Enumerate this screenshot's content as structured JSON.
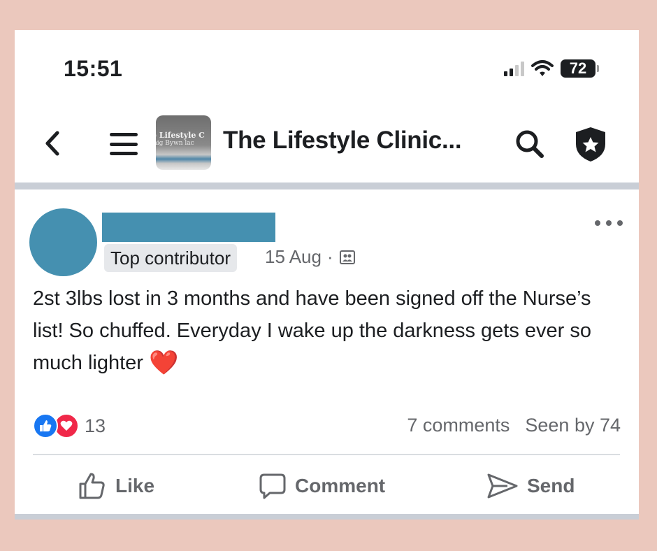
{
  "status_bar": {
    "time": "15:51",
    "battery": "72"
  },
  "nav": {
    "group_thumbnail_text_1": "e Lifestyle C",
    "group_thumbnail_text_2": "nig Bywn lac",
    "group_title": "The Lifestyle Clinic..."
  },
  "post": {
    "badge": "Top contributor",
    "date": "15 Aug",
    "separator": "·",
    "text": "2st 3lbs lost in 3 months and have been signed off the Nurse’s list! So chuffed. Everyday I wake up the darkness gets ever so much lighter",
    "emoji": "❤️",
    "reaction_count": "13",
    "comments": "7 comments",
    "seen_by": "Seen by 74"
  },
  "actions": {
    "like": "Like",
    "comment": "Comment",
    "send": "Send"
  },
  "colors": {
    "page_background": "#ebc8bd",
    "redaction": "#4590b0",
    "like_blue": "#1877f2",
    "love_red": "#f02849",
    "secondary_text": "#65676b"
  },
  "icons": [
    "back-chevron-icon",
    "menu-icon",
    "search-icon",
    "admin-shield-icon",
    "more-options-icon",
    "group-audience-icon",
    "like-reaction-icon",
    "love-reaction-icon",
    "thumbs-up-icon",
    "comment-icon",
    "send-icon",
    "signal-icon",
    "wifi-icon",
    "battery-icon"
  ]
}
